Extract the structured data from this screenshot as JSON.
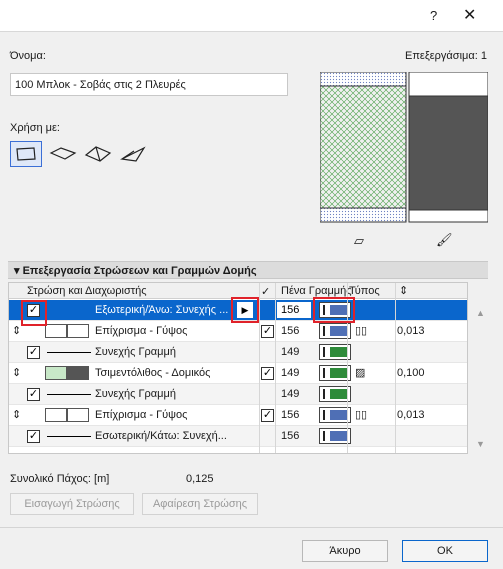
{
  "titlebar": {
    "help": "?",
    "close": "✕"
  },
  "name_label": "Όνομα:",
  "name_value": "100 Μπλοκ - Σοβάς στις 2 Πλευρές",
  "edit_label": "Επεξεργάσιμα: 1",
  "use_label": "Χρήση με:",
  "section_title": "Επεξεργασία Στρώσεων και Γραμμών Δομής",
  "columns": {
    "layers": "Στρώση και Διαχωριστής",
    "pen": "Πένα Γραμμής",
    "type": "Τύπος"
  },
  "rows": [
    {
      "label": "Εξωτερική/Άνω: Συνεχής ...",
      "pen": "156",
      "thickness": ""
    },
    {
      "label": "Επίχρισμα - Γύψος",
      "pen": "156",
      "thickness": "0,013"
    },
    {
      "label": "Συνεχής Γραμμή",
      "pen": "149",
      "thickness": ""
    },
    {
      "label": "Τσιμεντόλιθος - Δομικός",
      "pen": "149",
      "thickness": "0,100"
    },
    {
      "label": "Συνεχής Γραμμή",
      "pen": "149",
      "thickness": ""
    },
    {
      "label": "Επίχρισμα - Γύψος",
      "pen": "156",
      "thickness": "0,013"
    },
    {
      "label": "Εσωτερική/Κάτω: Συνεχή...",
      "pen": "156",
      "thickness": ""
    }
  ],
  "total_label": "Συνολικό Πάχος: [m]",
  "total_value": "0,125",
  "buttons": {
    "add": "Εισαγωγή Στρώσης",
    "remove": "Αφαίρεση Στρώσης",
    "cancel": "Άκυρο",
    "ok": "OK"
  },
  "colors": {
    "selected": "#0a66cc",
    "pen156": "#4f6fb5",
    "pen149": "#2e8b3a",
    "highlight": "#e0222a"
  }
}
